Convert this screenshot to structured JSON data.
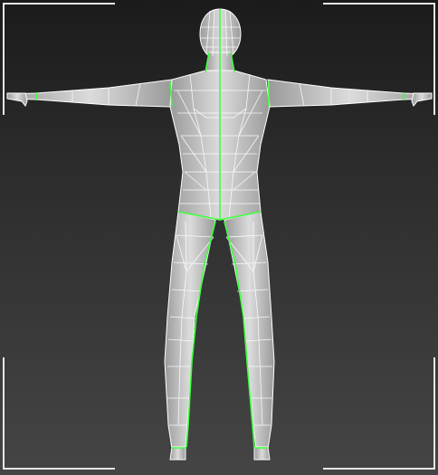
{
  "viewport": {
    "view": "back",
    "object_type": "low-poly human mesh (T-pose)",
    "colors": {
      "background_top": "#1b1b1b",
      "background_bottom": "#454545",
      "mesh_fill": "#c6c6c6",
      "wireframe": "#ffffff",
      "selected_edges": "#3cff3c",
      "safe_frame": "#e6e6e6"
    }
  }
}
